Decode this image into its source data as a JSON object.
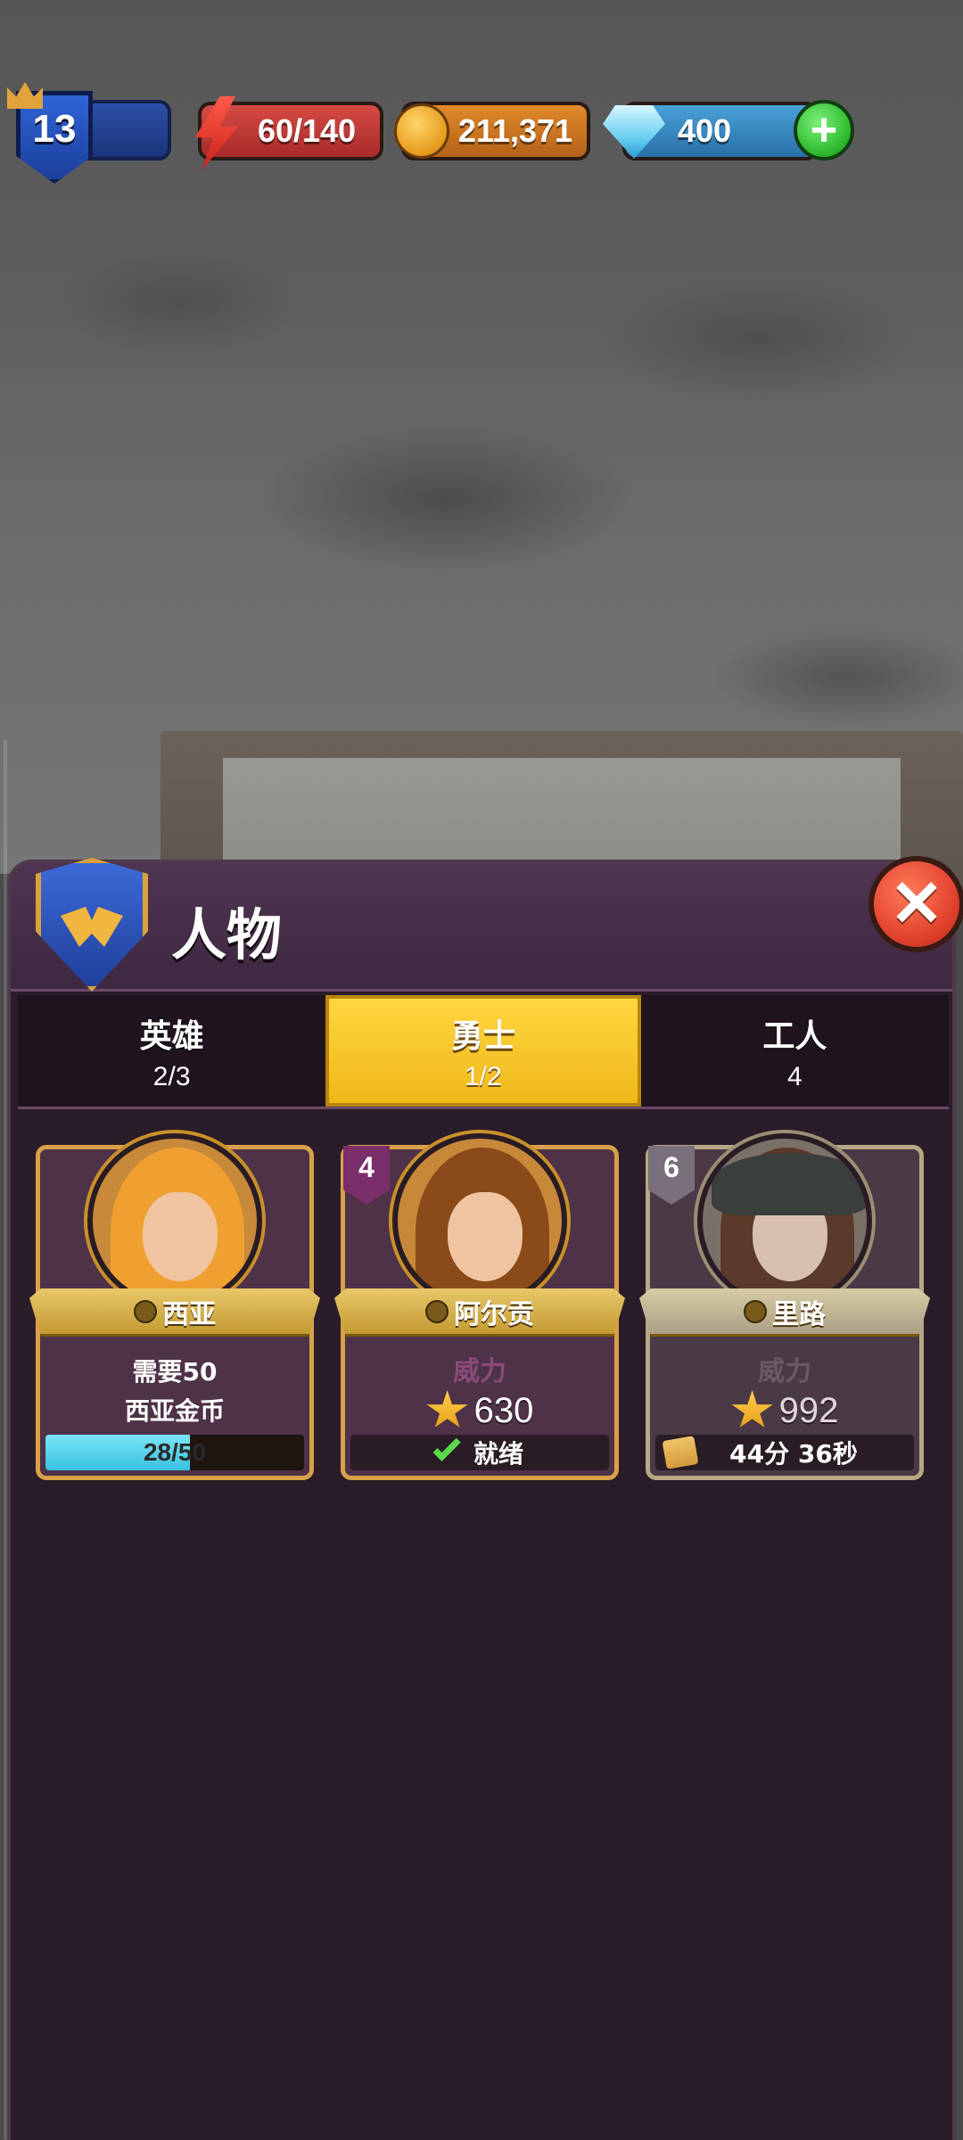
{
  "hud": {
    "level": "13",
    "energy": "60/140",
    "gold": "211,371",
    "gems": "400"
  },
  "panel": {
    "title": "人物"
  },
  "tabs": [
    {
      "label": "英雄",
      "count": "2/3"
    },
    {
      "label": "勇士",
      "count": "1/2"
    },
    {
      "label": "工人",
      "count": "4"
    }
  ],
  "cards": [
    {
      "name": "西亚",
      "requirement_line1": "需要50",
      "requirement_line2": "西亚金币",
      "progress_text": "28/50",
      "progress_current": 28,
      "progress_total": 50,
      "hair_color": "#f0a030"
    },
    {
      "rank": "4",
      "name": "阿尔贡",
      "power_label": "威力",
      "power": "630",
      "status": "就绪",
      "hair_color": "#8a4a1a"
    },
    {
      "rank": "6",
      "name": "里路",
      "power_label": "威力",
      "power": "992",
      "timer": "44分 36秒",
      "hair_color": "#5a3a2a"
    }
  ]
}
